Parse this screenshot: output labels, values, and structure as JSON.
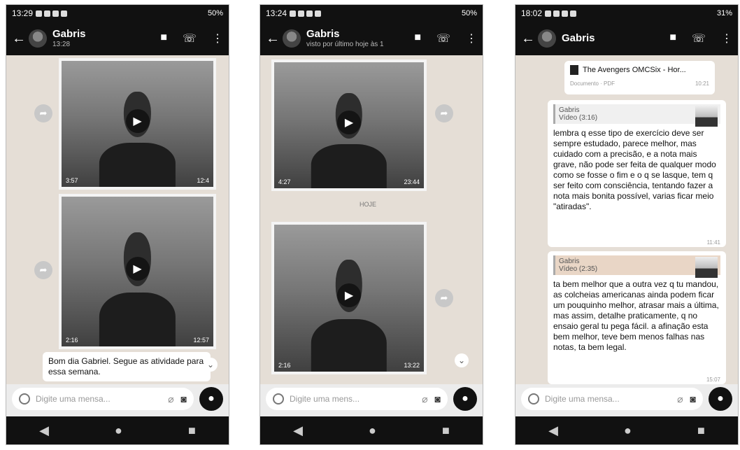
{
  "phones": [
    {
      "status": {
        "time": "13:29",
        "battery": "50%"
      },
      "contact": "Gabris",
      "subtitle": "13:28",
      "videos": [
        {
          "duration": "3:57",
          "time": "12:4"
        },
        {
          "duration": "2:16",
          "time": "12:57"
        }
      ],
      "text_message": "Bom dia Gabriel. Segue as atividade para essa semana.",
      "input_placeholder": "Digite uma mensa..."
    },
    {
      "status": {
        "time": "13:24",
        "battery": "50%"
      },
      "contact": "Gabris",
      "subtitle": "visto por último hoje às 1",
      "videos": [
        {
          "duration": "4:27",
          "time": "23:44"
        },
        {
          "duration": "2:16",
          "time": "13:22"
        }
      ],
      "date_chip": "HOJE",
      "input_placeholder": "Digite uma mens..."
    },
    {
      "status": {
        "time": "18:02",
        "battery": "31%"
      },
      "contact": "Gabris",
      "document": {
        "title": "The Avengers OMCSix - Hor...",
        "meta": "Documento · PDF",
        "time": "10:21"
      },
      "reply1": {
        "quote_name": "Gabris",
        "quote_meta": "Vídeo (3:16)",
        "text": "lembra q esse tipo de exercício deve ser sempre estudado, parece melhor, mas cuidado com a precisão, e a nota mais grave, não pode ser feita de qualquer modo como se fosse o fim e o q se lasque, tem q ser feito com consciência, tentando fazer a nota mais bonita possível, varias ficar meio \"atiradas\".",
        "time": "11:41"
      },
      "reply2": {
        "quote_name": "Gabris",
        "quote_meta": "Vídeo (2:35)",
        "text": "ta bem melhor que a outra vez q tu mandou, as colcheias americanas ainda podem ficar um pouquinho melhor, atrasar mais a última, mas assim, detalhe praticamente, q no ensaio geral tu pega fácil. a afinação esta bem melhor, teve bem menos falhas nas notas, ta bem legal.",
        "time": "15:07"
      },
      "input_placeholder": "Digite uma mensa..."
    }
  ],
  "icons": [
    "back-arrow-icon",
    "video-call-icon",
    "phone-icon",
    "more-icon",
    "play-icon",
    "forward-icon",
    "emoji-icon",
    "attach-icon",
    "camera-icon",
    "mic-icon",
    "nav-back-icon",
    "nav-home-icon",
    "nav-recent-icon"
  ]
}
